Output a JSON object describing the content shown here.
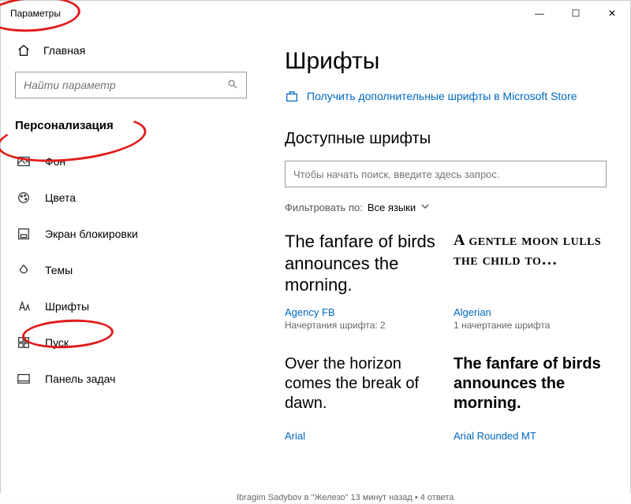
{
  "window": {
    "title": "Параметры"
  },
  "win_controls": {
    "min": "—",
    "max": "☐",
    "close": "✕"
  },
  "sidebar": {
    "home": "Главная",
    "search_placeholder": "Найти параметр",
    "category": "Персонализация",
    "items": [
      {
        "label": "Фон"
      },
      {
        "label": "Цвета"
      },
      {
        "label": "Экран блокировки"
      },
      {
        "label": "Темы"
      },
      {
        "label": "Шрифты"
      },
      {
        "label": "Пуск"
      },
      {
        "label": "Панель задач"
      }
    ]
  },
  "main": {
    "title": "Шрифты",
    "store_link": "Получить дополнительные шрифты в Microsoft Store",
    "section_title": "Доступные шрифты",
    "font_search_placeholder": "Чтобы начать поиск, введите здесь запрос.",
    "filter_label": "Фильтровать по:",
    "filter_value": "Все языки",
    "fonts": [
      {
        "sample": "The fanfare of birds announces the morning.",
        "name": "Agency FB",
        "faces": "Начертания шрифта: 2",
        "cls": "sample-agency"
      },
      {
        "sample": "A gentle moon lulls the child to…",
        "name": "Algerian",
        "faces": "1 начертание шрифта",
        "cls": "sample-algerian"
      },
      {
        "sample": "Over the horizon comes the break of dawn.",
        "name": "Arial",
        "faces": "",
        "cls": "sample-arial"
      },
      {
        "sample": "The fanfare of birds announces the morning.",
        "name": "Arial Rounded MT",
        "faces": "",
        "cls": "sample-arial-rounded"
      }
    ]
  },
  "footer_fragment": "Ibragim Sadybov в \"Железо\"  13 минут назад   •   4 ответа"
}
